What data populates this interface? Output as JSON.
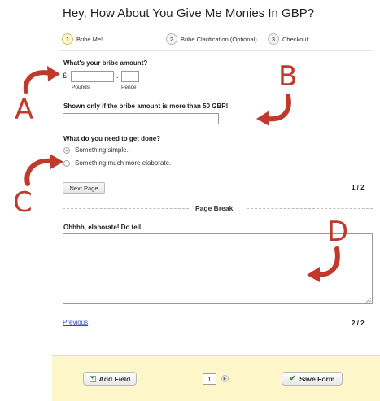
{
  "page": {
    "title": "Hey, How About You Give Me Monies In GBP?"
  },
  "steps": [
    {
      "number": "1",
      "label": "Bribe Me!",
      "active": true
    },
    {
      "number": "2",
      "label": "Bribe Clarification (Optional)",
      "active": false
    },
    {
      "number": "3",
      "label": "Checkout",
      "active": false
    }
  ],
  "form": {
    "amount": {
      "label": "What's your bribe amount?",
      "currency_symbol": "£",
      "separator": ".",
      "pounds_label": "Pounds",
      "pence_label": "Pence",
      "pounds_value": "",
      "pence_value": ""
    },
    "conditional_field": {
      "label": "Shown only if the bribe amount is more than 50 GBP!",
      "value": ""
    },
    "task": {
      "label": "What do you need to get done?",
      "options": [
        {
          "label": "Something simple.",
          "checked": true
        },
        {
          "label": "Something much more elaborate.",
          "checked": false
        }
      ]
    },
    "next_button": "Next Page",
    "page1_count": "1 / 2",
    "page_break_label": "Page Break",
    "elaborate": {
      "label": "Ohhhh, elaborate! Do tell.",
      "value": ""
    },
    "previous_link": "Previous",
    "page2_count": "2 / 2"
  },
  "footer": {
    "add_field_label": "Add Field",
    "page_number": "1",
    "save_form_label": "Save Form"
  },
  "annotations": {
    "a": "A",
    "b": "B",
    "c": "C",
    "d": "D",
    "color": "#c0392b"
  },
  "colors": {
    "link": "#2a4fb5",
    "footer_background": "#fcf6c8",
    "active_step": "#fff6cf"
  }
}
